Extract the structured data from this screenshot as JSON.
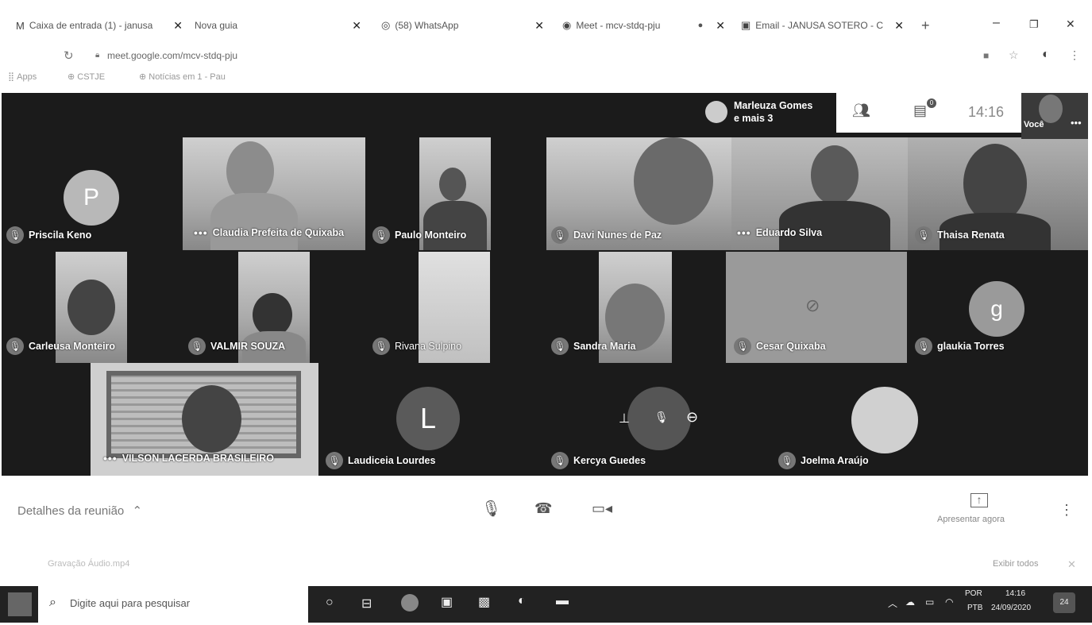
{
  "browser": {
    "tabs": [
      {
        "label": "Caixa de entrada (1) - janusa",
        "icon": "gmail-icon"
      },
      {
        "label": "Nova guia",
        "icon": "tab-icon"
      },
      {
        "label": "(58) WhatsApp",
        "icon": "whatsapp-icon"
      },
      {
        "label": "Meet - mcv-stdq-pju",
        "icon": "meet-icon"
      },
      {
        "label": "Email - JANUSA SOTERO - C",
        "icon": "outlook-icon"
      }
    ],
    "new_tab": "+",
    "address": "meet.google.com/mcv-stdq-pju",
    "bookmarks": [
      "Apps",
      "CSTJE",
      "Notícias em 1 - Pau"
    ]
  },
  "meet": {
    "presenter": {
      "name": "Marleuza Gomes",
      "more": "e mais 3"
    },
    "chat_badge": "0",
    "time": "14:16",
    "self_label": "Você",
    "participants": [
      {
        "name": "Priscila Keno",
        "avatar_letter": "P"
      },
      {
        "name": "Claudia Prefeita de Quixaba"
      },
      {
        "name": "Paulo Monteiro"
      },
      {
        "name": "Davi Nunes de Paz"
      },
      {
        "name": "Eduardo Silva"
      },
      {
        "name": "Thaisa Renata"
      },
      {
        "name": "Carleusa Monteiro"
      },
      {
        "name": "VALMIR SOUZA"
      },
      {
        "name": "Rivana Sulpino"
      },
      {
        "name": "Sandra Maria"
      },
      {
        "name": "Cesar Quixaba"
      },
      {
        "name": "glaukia Torres",
        "avatar_letter": "g"
      },
      {
        "name": "VILSON LACERDA BRASILEIRO"
      },
      {
        "name": "Laudiceia Lourdes",
        "avatar_letter": "L"
      },
      {
        "name": "Kercya Guedes"
      },
      {
        "name": "Joelma Araújo"
      }
    ],
    "details_label": "Detalhes da reunião",
    "present_label": "Apresentar agora"
  },
  "download_bar": {
    "item": "Gravação Áudio.mp4",
    "show_all": "Exibir todos"
  },
  "taskbar": {
    "search_placeholder": "Digite aqui para pesquisar",
    "lang": "POR",
    "layout": "PTB",
    "time": "14:16",
    "date": "24/09/2020",
    "notif": "24"
  }
}
